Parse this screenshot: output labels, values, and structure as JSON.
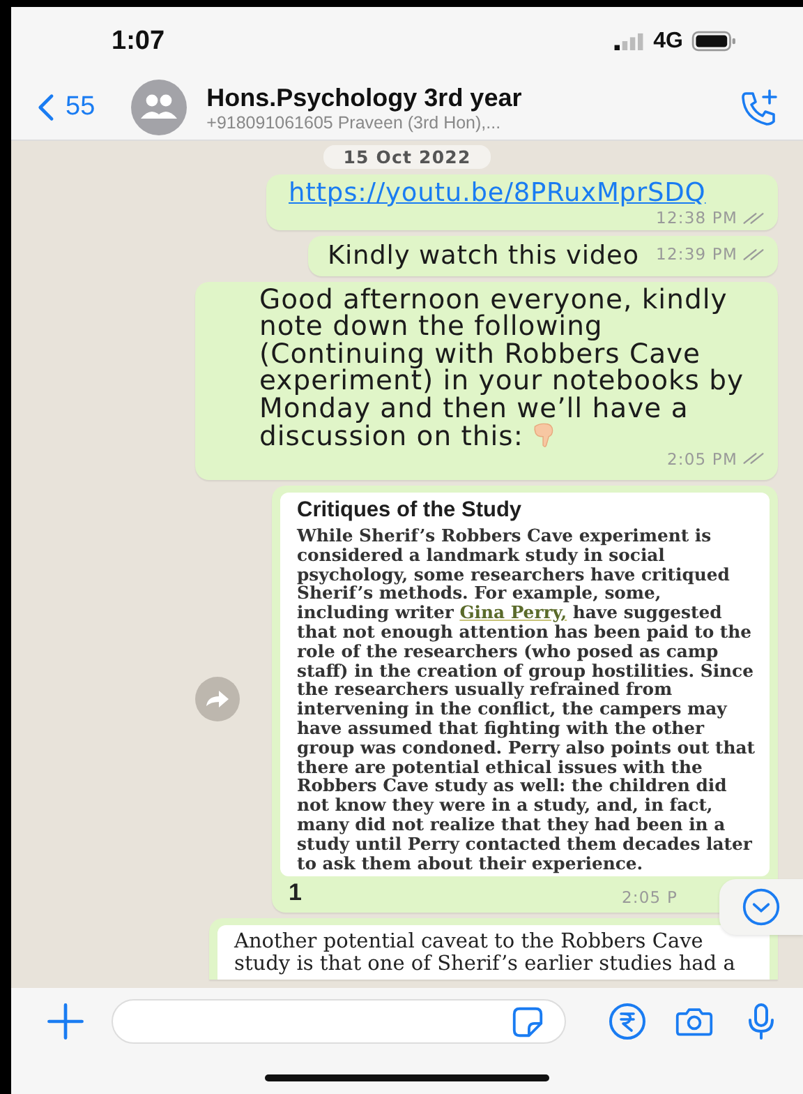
{
  "status_bar": {
    "time": "1:07",
    "network": "4G"
  },
  "header": {
    "back_count": "55",
    "title": "Hons.Psychology 3rd year",
    "subtitle": "+918091061605 Praveen (3rd Hon),..."
  },
  "date_chip": "15 Oct 2022",
  "messages": [
    {
      "kind": "link",
      "text": "https://youtu.be/8PRuxMprSDQ",
      "time": "12:38 PM",
      "read": false
    },
    {
      "kind": "text",
      "text": "Kindly watch this video",
      "time": "12:39 PM",
      "read": false
    },
    {
      "kind": "text",
      "text": "Good afternoon everyone, kindly note down the following (Continuing with Robbers Cave experiment) in your notebooks by Monday and then we’ll have a discussion on this:",
      "time": "2:05 PM",
      "read": false,
      "emoji": true
    },
    {
      "kind": "document",
      "heading": "Critiques of the Study",
      "body_before": "While Sherif’s Robbers Cave experiment is considered a landmark study in social psychology, some researchers have critiqued Sherif’s methods. For example, some, including writer ",
      "body_link": "Gina Perry,",
      "body_after": " have suggested that not enough attention has been paid to the role of the researchers (who posed as camp staff) in the creation of group hostilities. Since the researchers usually refrained from intervening in the conflict, the campers may have assumed that fighting with the other group was condoned. Perry also points out that there are potential ethical issues with the Robbers Cave study as well: the children did not know they were in a study, and, in fact, many did not realize that they had been in a study until Perry contacted them decades later to ask them about their experience.",
      "caption": "1",
      "time": "2:05 P",
      "forward": true
    },
    {
      "kind": "document",
      "body_before": "Another potential caveat to the Robbers Cave study is that one of Sherif’s earlier studies had a"
    }
  ]
}
